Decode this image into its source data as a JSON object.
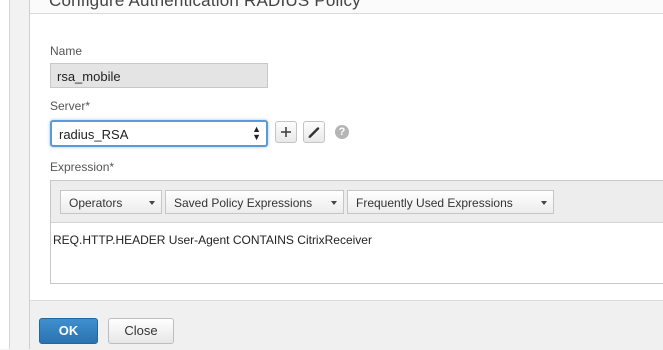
{
  "dialog": {
    "title": "Configure Authentication RADIUS Policy"
  },
  "form": {
    "name_label": "Name",
    "name_value": "rsa_mobile",
    "server_label": "Server*",
    "server_value": "radius_RSA",
    "add_icon": "plus-icon",
    "edit_icon": "pencil-icon",
    "help_icon": "question-icon",
    "help_glyph": "?",
    "expression_label": "Expression*",
    "expression_dropdowns": [
      "Operators",
      "Saved Policy Expressions",
      "Frequently Used Expressions"
    ],
    "expression_value": "REQ.HTTP.HEADER User-Agent CONTAINS CitrixReceiver"
  },
  "buttons": {
    "ok": "OK",
    "close": "Close"
  },
  "colors": {
    "primary": "#2f7fc1",
    "focus": "#5b9ad9"
  }
}
